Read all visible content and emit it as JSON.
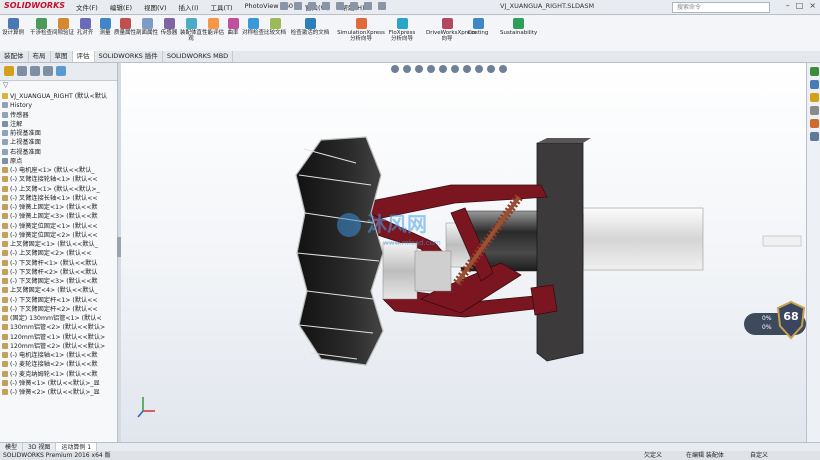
{
  "app": {
    "logo": "SOLIDWORKS",
    "menus": [
      "文件(F)",
      "编辑(E)",
      "视图(V)",
      "插入(I)",
      "工具(T)",
      "PhotoView 360",
      "窗口(W)",
      "帮助(H)"
    ],
    "document_title": "VJ_XUANGUA_RIGHT.SLDASM",
    "search_placeholder": "搜索命令"
  },
  "toolbar": {
    "items": [
      "设计算例",
      "干涉检查",
      "间隙验证",
      "孔对齐",
      "测量",
      "质量属性",
      "剖面属性",
      "传感器",
      "装配体直观",
      "性能评估",
      "曲率",
      "对称检查",
      "比较文档",
      "检查激活的文档",
      "SimulationXpress 分析向导",
      "FloXpress 分析向导",
      "DriveWorksXpress 向导",
      "Costing",
      "Sustainability"
    ],
    "tool_colors": [
      "#4a78b5",
      "#4a9b5a",
      "#d6892f",
      "#6a6ab8",
      "#3f87c6",
      "#c0504d",
      "#7e9bc5",
      "#8064a2",
      "#4bacc6",
      "#f79646",
      "#c04f9d",
      "#3a9ad9",
      "#9bbb59",
      "#2c7fb8",
      "#e06a3a",
      "#2aa4c9",
      "#b5485e",
      "#3f87c6",
      "#2e9e5b"
    ]
  },
  "command_tabs": [
    {
      "label": "装配体",
      "active": false
    },
    {
      "label": "布局",
      "active": false
    },
    {
      "label": "草图",
      "active": false
    },
    {
      "label": "评估",
      "active": true
    },
    {
      "label": "SOLIDWORKS 插件",
      "active": false
    },
    {
      "label": "SOLIDWORKS MBD",
      "active": false
    }
  ],
  "feature_tree": {
    "items": [
      {
        "label": "VJ_XUANGUA_RIGHT (默认<默认",
        "icon": "assembly-icon"
      },
      {
        "label": "History",
        "icon": "history-icon"
      },
      {
        "label": "传感器",
        "icon": "sensor-icon"
      },
      {
        "label": "注解",
        "icon": "annotation-icon"
      },
      {
        "label": "前视基准面",
        "icon": "plane-icon"
      },
      {
        "label": "上视基准面",
        "icon": "plane-icon"
      },
      {
        "label": "右视基准面",
        "icon": "plane-icon"
      },
      {
        "label": "原点",
        "icon": "origin-icon"
      },
      {
        "label": "(-) 电机座<1> (默认<<默认_",
        "icon": "part-icon"
      },
      {
        "label": "(-) 叉臂连接轮轴<1> (默认<<",
        "icon": "part-icon"
      },
      {
        "label": "(-) 上叉臂<1> (默认<<默认>_",
        "icon": "part-icon"
      },
      {
        "label": "(-) 叉臂连接长轴<1> (默认<<",
        "icon": "part-icon"
      },
      {
        "label": "(-) 弹簧上固定<1> (默认<<默",
        "icon": "part-icon"
      },
      {
        "label": "(-) 弹簧上固定<3> (默认<<默",
        "icon": "part-icon"
      },
      {
        "label": "(-) 弹簧定位固定<1> (默认<<",
        "icon": "part-icon"
      },
      {
        "label": "(-) 弹簧定位固定<2> (默认<<",
        "icon": "part-icon"
      },
      {
        "label": "上叉臂固定<1> (默认<<默认_",
        "icon": "part-icon"
      },
      {
        "label": "(-) 上叉臂固定<2> (默认<<",
        "icon": "part-icon"
      },
      {
        "label": "(-) 下叉臂杆<1> (默认<<默认",
        "icon": "part-icon"
      },
      {
        "label": "(-) 下叉臂杆<2> (默认<<默认",
        "icon": "part-icon"
      },
      {
        "label": "(-) 下叉臂固定<3> (默认<<默",
        "icon": "part-icon"
      },
      {
        "label": "上叉臂固定<4> (默认<<默认_",
        "icon": "part-icon"
      },
      {
        "label": "(-) 下叉臂固定杆<1> (默认<<",
        "icon": "part-icon"
      },
      {
        "label": "(-) 下叉臂固定杆<2> (默认<<",
        "icon": "part-icon"
      },
      {
        "label": "(固定) 130mm铝管<1> (默认<",
        "icon": "part-icon"
      },
      {
        "label": "130mm铝管<2> (默认<<默认>",
        "icon": "part-icon"
      },
      {
        "label": "120mm铝管<1> (默认<<默认>",
        "icon": "part-icon"
      },
      {
        "label": "120mm铝管<2> (默认<<默认>",
        "icon": "part-icon"
      },
      {
        "label": "(-) 电机连接轴<1> (默认<<默",
        "icon": "part-icon"
      },
      {
        "label": "(-) 麦轮连接轴<2> (默认<<默",
        "icon": "part-icon"
      },
      {
        "label": "(-) 麦克纳姆轮<1> (默认<<默",
        "icon": "part-icon"
      },
      {
        "label": "(-) 弹簧<1> (默认<<默认>_显",
        "icon": "part-icon"
      },
      {
        "label": "(-) 弹簧<2> (默认<<默认>_显",
        "icon": "part-icon"
      }
    ]
  },
  "viewport": {
    "watermark_title": "沐风网",
    "watermark_url": "www.mfcad.com"
  },
  "bottom_tabs": [
    {
      "label": "模型",
      "active": false
    },
    {
      "label": "3D 视图",
      "active": false
    },
    {
      "label": "运动算例 1",
      "active": true
    }
  ],
  "status": {
    "left": "SOLIDWORKS Premium 2016 x64 版",
    "r1": "欠定义",
    "r2": "在编辑 装配体",
    "r3": "自定义"
  },
  "badge": {
    "line1": "0%",
    "line2": "0%",
    "level": "68"
  }
}
